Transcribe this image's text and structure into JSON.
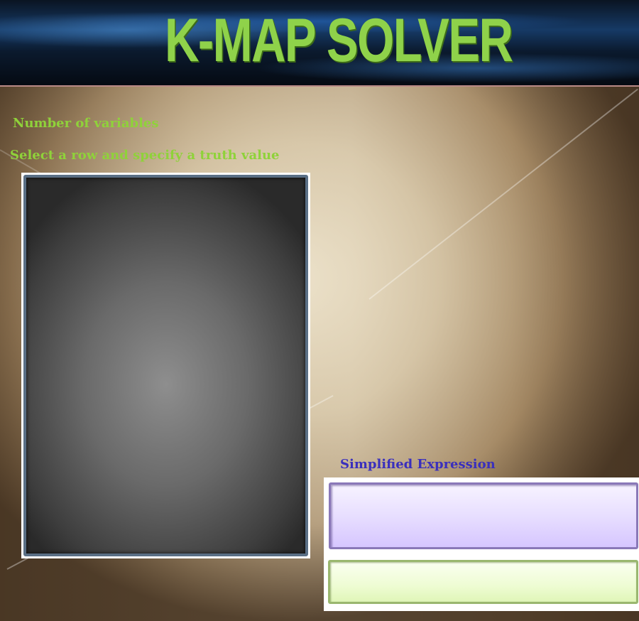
{
  "header": {
    "title": "K-MAP SOLVER"
  },
  "labels": {
    "number_of_variables": "Number of variables",
    "select_row": "Select a row and specify a truth value",
    "simplified_expression": "Simplified Expression"
  },
  "outputs": {
    "expression_value": "",
    "result_value": ""
  },
  "colors": {
    "title_green": "#8fd24a",
    "label_green": "#8fd23a",
    "label_blue": "#3a2fbd",
    "expression_bg": "#e6dcff",
    "result_bg": "#eefcd3"
  }
}
